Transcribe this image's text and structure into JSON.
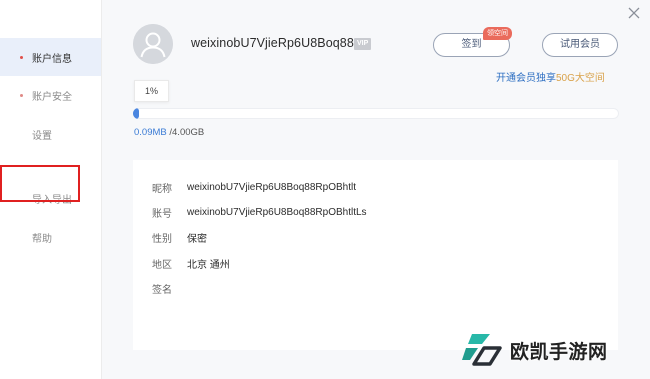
{
  "sidebar": {
    "items": [
      {
        "label": "账户信息"
      },
      {
        "label": "账户安全"
      },
      {
        "label": "设置"
      },
      {
        "label": "导入导出"
      },
      {
        "label": "帮助"
      }
    ]
  },
  "profile": {
    "username": "weixinobU7VjieRp6U8Boq88..",
    "vip_badge": "VIP",
    "checkin_label": "签到",
    "checkin_tag": "领空间",
    "trial_label": "试用会员",
    "promo_prefix": "开通会员独享",
    "promo_highlight": "50G大空间"
  },
  "storage": {
    "percent_label": "1%",
    "fraction_used": 0.01,
    "used": "0.09MB",
    "total": " /4.00GB"
  },
  "info": {
    "rows": [
      {
        "label": "昵称",
        "value": "weixinobU7VjieRp6U8Boq88RpOBhtlt"
      },
      {
        "label": "账号",
        "value": "weixinobU7VjieRp6U8Boq88RpOBhtltLs"
      },
      {
        "label": "性别",
        "value": "保密"
      },
      {
        "label": "地区",
        "value": "北京 通州"
      },
      {
        "label": "签名",
        "value": ""
      }
    ]
  },
  "watermark": {
    "text": "欧凯手游网"
  },
  "colors": {
    "accent": "#4a86e0",
    "active_nav_bg": "#e9effa",
    "tag_red": "#ea6b5c",
    "highlight_gold": "#d9a24a"
  }
}
